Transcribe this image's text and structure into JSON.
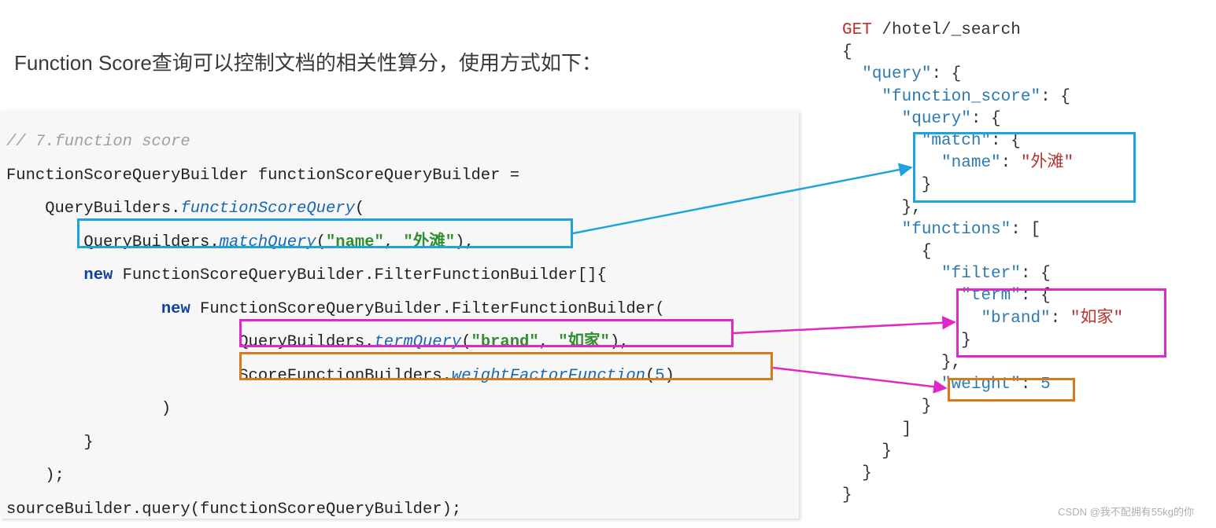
{
  "title": "Function Score查询可以控制文档的相关性算分，使用方式如下：",
  "java": {
    "comment": "// 7.function score",
    "line1": "FunctionScoreQueryBuilder functionScoreQueryBuilder =",
    "line2_pre": "    QueryBuilders.",
    "line2_method": "functionScoreQuery",
    "line2_post": "(",
    "line3_pre": "        QueryBuilders.",
    "line3_method": "matchQuery",
    "line3_paren_open": "(",
    "line3_arg1": "\"name\"",
    "line3_comma": ", ",
    "line3_arg2": "\"外滩\"",
    "line3_close": "),",
    "line4_pre": "        ",
    "line4_new": "new",
    "line4_rest": " FunctionScoreQueryBuilder.FilterFunctionBuilder[]{",
    "line5_pre": "                ",
    "line5_new": "new",
    "line5_rest": " FunctionScoreQueryBuilder.FilterFunctionBuilder(",
    "line6_pre": "                        QueryBuilders.",
    "line6_method": "termQuery",
    "line6_paren_open": "(",
    "line6_arg1": "\"brand\"",
    "line6_comma": ", ",
    "line6_arg2": "\"如家\"",
    "line6_close": "),",
    "line7_pre": "                        ScoreFunctionBuilders.",
    "line7_method": "weightFactorFunction",
    "line7_open": "(",
    "line7_num": "5",
    "line7_close": ")",
    "line8": "                )",
    "line9": "        }",
    "line10": "    );",
    "line11": "sourceBuilder.query(functionScoreQueryBuilder);"
  },
  "json_dsl": {
    "l1_verb": "GET",
    "l1_path": " /hotel/_search",
    "l2": "{",
    "l3_pre": "  ",
    "l3_key": "\"query\"",
    "l3_post": ": {",
    "l4_pre": "    ",
    "l4_key": "\"function_score\"",
    "l4_post": ": {",
    "l5_pre": "      ",
    "l5_key": "\"query\"",
    "l5_post": ": {",
    "l6_pre": "        ",
    "l6_key": "\"match\"",
    "l6_post": ": {",
    "l7_pre": "          ",
    "l7_key": "\"name\"",
    "l7_mid": ": ",
    "l7_val": "\"外滩\"",
    "l8": "        }",
    "l9": "      },",
    "l10_pre": "      ",
    "l10_key": "\"functions\"",
    "l10_post": ": [",
    "l11": "        {",
    "l12_pre": "          ",
    "l12_key": "\"filter\"",
    "l12_post": ": {",
    "l13_pre": "            ",
    "l13_key": "\"term\"",
    "l13_post": ": {",
    "l14_pre": "              ",
    "l14_key": "\"brand\"",
    "l14_mid": ": ",
    "l14_val": "\"如家\"",
    "l15": "            }",
    "l16": "          },",
    "l17_pre": "          ",
    "l17_key": "\"weight\"",
    "l17_mid": ": ",
    "l17_num": "5",
    "l18": "        }",
    "l19": "      ]",
    "l20": "    }",
    "l21": "  }",
    "l22": "}"
  },
  "watermark": "CSDN @我不配拥有55kg的你"
}
